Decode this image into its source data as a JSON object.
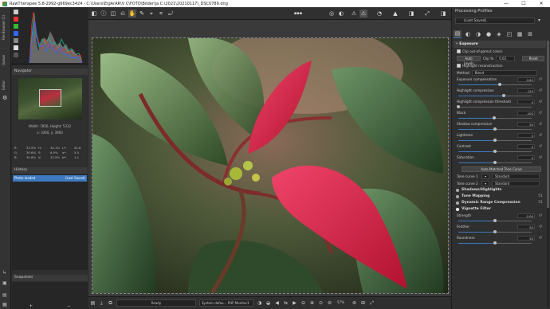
{
  "window": {
    "title": "RawTherapee 5.8-2992-g669ec3424 - C:\\Users\\EigArAR\\V C\\FOTO\\Bilder\\ja C:\\2021\\20210117\\_DSC0789.dng",
    "minimize": "—",
    "maximize": "☐",
    "close": "✕"
  },
  "left_strip": {
    "file_browser_tab": "File Browser (1)",
    "queue_tab": "Queue",
    "editor_tab": "Editor"
  },
  "navigator": {
    "title": "Navigator",
    "size_text": "Width: 7856, Height: 5312",
    "coord_text": "x: 3360, y: 3983",
    "values": [
      "R:",
      "32.5%",
      "H:",
      "34.1%",
      "L*:",
      "41.6",
      "G:",
      "30.6%",
      "S:",
      "6.0%",
      "a*:",
      "5.0",
      "B:",
      "30.6%",
      "V:",
      "32.5%",
      "b*:",
      "1.1"
    ]
  },
  "history": {
    "title": "History",
    "entry_label": "Photo loaded",
    "entry_value": "(Last Saved)"
  },
  "snapshots": {
    "title": "Snapshots",
    "add": "+",
    "remove": "−"
  },
  "status": {
    "ready": "Ready",
    "output_profile": "System defau...  PHP Monitor3",
    "zoom": "57%"
  },
  "right_panel": {
    "title": "Processing Profiles",
    "profile": "(Last Saved)",
    "exposure": {
      "title": "Exposure",
      "clip_label": "Clip out-of-gamut colors",
      "auto_levels": "Auto Levels",
      "clip_pct_label": "Clip %",
      "clip_pct_value": "0.02",
      "reset": "Reset",
      "highlight_recon": "Highlight reconstruction",
      "method_label": "Method",
      "method_value": "Blend",
      "sliders": [
        {
          "name": "Exposure compensation",
          "value": "0.61",
          "pos": 0.56
        },
        {
          "name": "Highlight compression",
          "value": "125",
          "pos": 0.62
        },
        {
          "name": "Highlight compression threshold",
          "value": "0",
          "pos": 0.0
        },
        {
          "name": "Black",
          "value": "-100",
          "pos": 0.49
        },
        {
          "name": "Shadow compression",
          "value": "50",
          "pos": 0.5
        },
        {
          "name": "Lightness",
          "value": "0",
          "pos": 0.5
        },
        {
          "name": "Contrast",
          "value": "0",
          "pos": 0.5
        },
        {
          "name": "Saturation",
          "value": "0",
          "pos": 0.5
        }
      ],
      "tone_curve_btn": "Auto-Matched Tone Curve",
      "tone_curve_1": "Tone curve 1",
      "tone_curve_2": "Tone curve 2",
      "curve_mode": "Standard"
    },
    "sections": [
      {
        "name": "Shadows/Highlights",
        "badge": ""
      },
      {
        "name": "Tone Mapping",
        "badge": "51"
      },
      {
        "name": "Dynamic Range Compression",
        "badge": "51"
      },
      {
        "name": "Vignette Filter",
        "badge": ""
      }
    ],
    "vignette": {
      "strength_label": "Strength",
      "strength_value": "0.00",
      "strength_pos": 0.5,
      "feather_label": "Feather",
      "feather_value": "50",
      "feather_pos": 0.5,
      "roundness_label": "Roundness",
      "roundness_value": "50",
      "roundness_pos": 0.5
    }
  }
}
